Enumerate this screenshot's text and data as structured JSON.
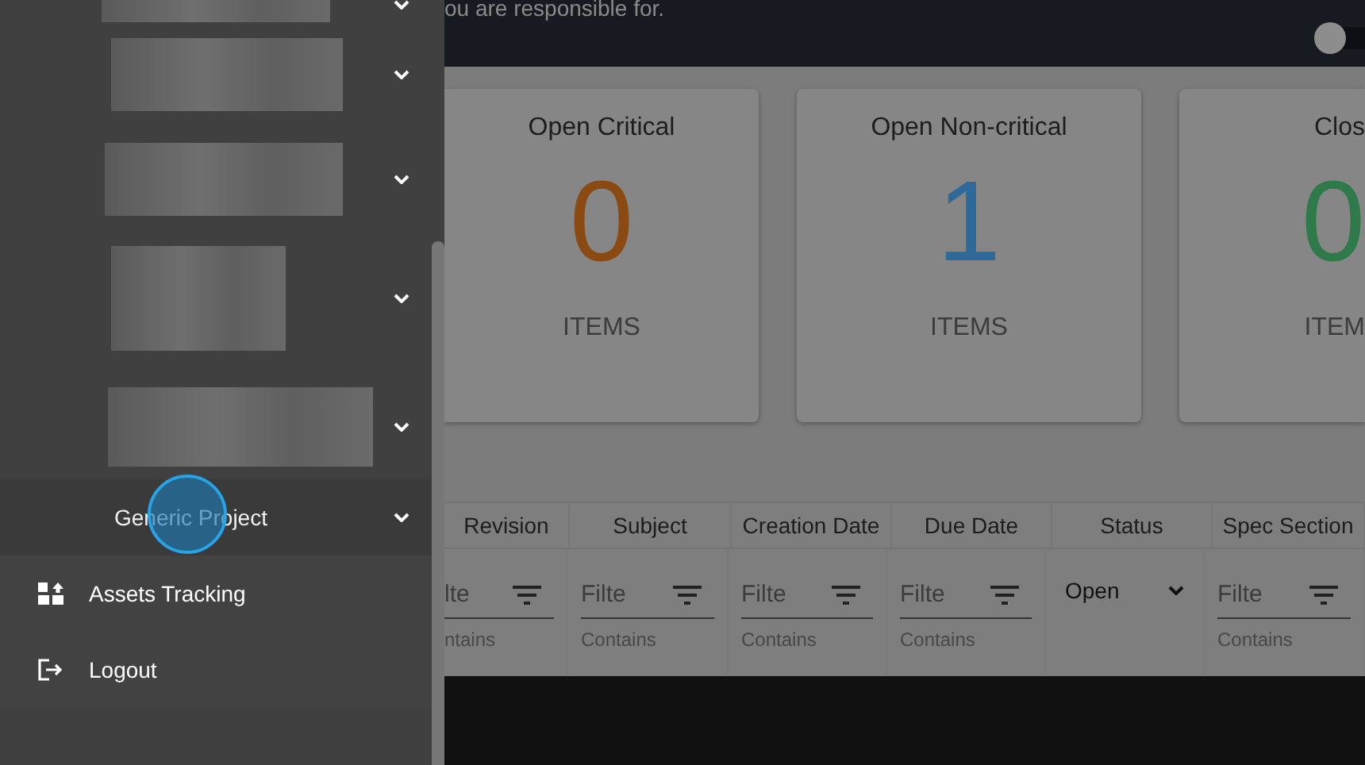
{
  "sidebar": {
    "groups": [
      {
        "kind": "blurred"
      },
      {
        "kind": "blurred"
      },
      {
        "kind": "blurred"
      },
      {
        "kind": "blurred"
      },
      {
        "kind": "blurred"
      },
      {
        "kind": "label",
        "label": "Generic Project"
      }
    ],
    "items": [
      {
        "kind": "assets",
        "label": "Assets Tracking"
      },
      {
        "kind": "logout",
        "label": "Logout"
      }
    ]
  },
  "header": {
    "text": "ou are responsible for.",
    "toggle": {
      "on": false
    }
  },
  "cards": [
    {
      "title": "Open Critical",
      "count": "0",
      "unit": "ITEMS",
      "color": "#8a4a12"
    },
    {
      "title": "Open Non-critical",
      "count": "1",
      "unit": "ITEMS",
      "color": "#2d6a9a"
    },
    {
      "title": "Clos",
      "count": "0",
      "unit": "ITEM",
      "color": "#2f7a4b"
    }
  ],
  "table": {
    "columns": [
      {
        "label": "Revision",
        "filter": {
          "kind": "text",
          "placeholder": "lte",
          "hint": "ntains"
        }
      },
      {
        "label": "Subject",
        "filter": {
          "kind": "text",
          "placeholder": "Filte",
          "hint": "Contains"
        }
      },
      {
        "label": "Creation Date",
        "filter": {
          "kind": "text",
          "placeholder": "Filte",
          "hint": "Contains"
        }
      },
      {
        "label": "Due Date",
        "filter": {
          "kind": "text",
          "placeholder": "Filte",
          "hint": "Contains"
        }
      },
      {
        "label": "Status",
        "filter": {
          "kind": "select",
          "value": "Open"
        }
      },
      {
        "label": "Spec Section",
        "filter": {
          "kind": "text",
          "placeholder": "Filte",
          "hint": "Contains"
        }
      }
    ]
  }
}
